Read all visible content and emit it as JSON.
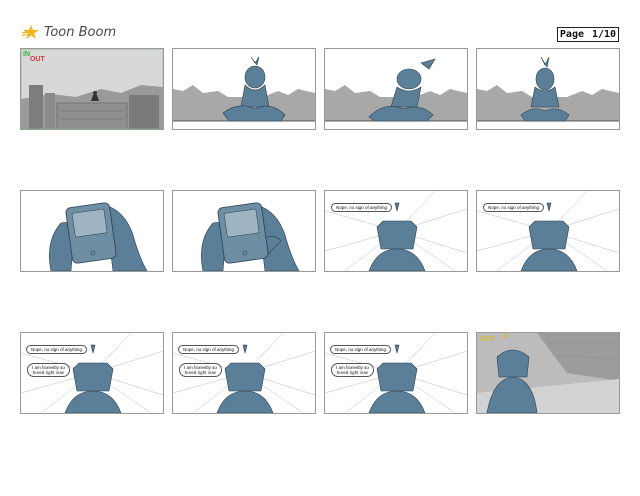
{
  "header": {
    "logo_text": "Toon Boom",
    "page_label": "Page",
    "page_number": "1/10"
  },
  "markers": {
    "in": "IN",
    "out": "OUT",
    "p": "P"
  },
  "dialogue": {
    "line1": "Nope, no sign of anything",
    "line2a": "I am honestly so",
    "line2b": "bored right now"
  },
  "colors": {
    "character": "#5b7f98",
    "background_gray": "#a8a8a8",
    "in_marker": "#3fae3f",
    "out_marker": "#d23a3a",
    "out_marker_last": "#d9b82a",
    "logo_star": "#f2b51c"
  }
}
